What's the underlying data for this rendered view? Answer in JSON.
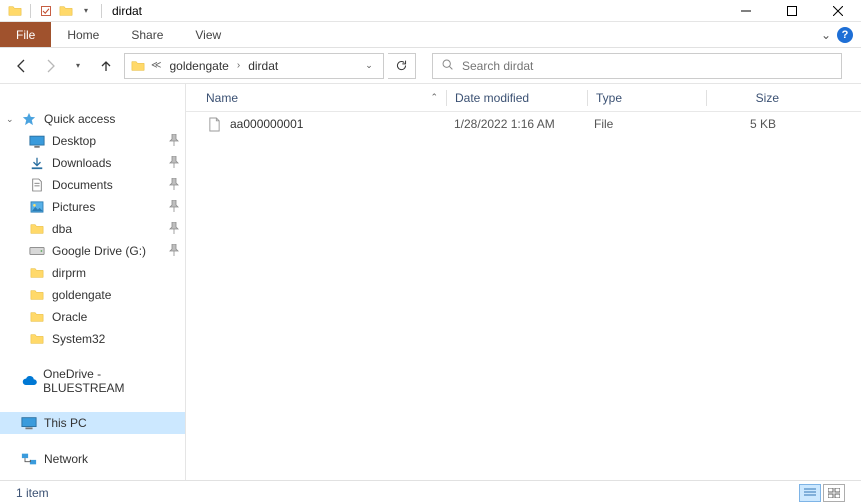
{
  "window": {
    "title": "dirdat"
  },
  "ribbon": {
    "file": "File",
    "tabs": [
      "Home",
      "Share",
      "View"
    ]
  },
  "breadcrumb": {
    "parts": [
      "goldengate",
      "dirdat"
    ]
  },
  "search": {
    "placeholder": "Search dirdat"
  },
  "sidebar": {
    "quick_access": "Quick access",
    "items": [
      {
        "label": "Desktop",
        "icon": "desktop",
        "pinned": true
      },
      {
        "label": "Downloads",
        "icon": "downloads",
        "pinned": true
      },
      {
        "label": "Documents",
        "icon": "documents",
        "pinned": true
      },
      {
        "label": "Pictures",
        "icon": "pictures",
        "pinned": true
      },
      {
        "label": "dba",
        "icon": "folder",
        "pinned": true
      },
      {
        "label": "Google Drive (G:)",
        "icon": "drive",
        "pinned": true
      },
      {
        "label": "dirprm",
        "icon": "folder",
        "pinned": false
      },
      {
        "label": "goldengate",
        "icon": "folder",
        "pinned": false
      },
      {
        "label": "Oracle",
        "icon": "folder",
        "pinned": false
      },
      {
        "label": "System32",
        "icon": "folder",
        "pinned": false
      }
    ],
    "onedrive": "OneDrive - BLUESTREAM",
    "this_pc": "This PC",
    "network": "Network"
  },
  "columns": {
    "name": "Name",
    "date": "Date modified",
    "type": "Type",
    "size": "Size"
  },
  "files": [
    {
      "name": "aa000000001",
      "date": "1/28/2022 1:16 AM",
      "type": "File",
      "size": "5 KB"
    }
  ],
  "status": {
    "count": "1 item"
  }
}
